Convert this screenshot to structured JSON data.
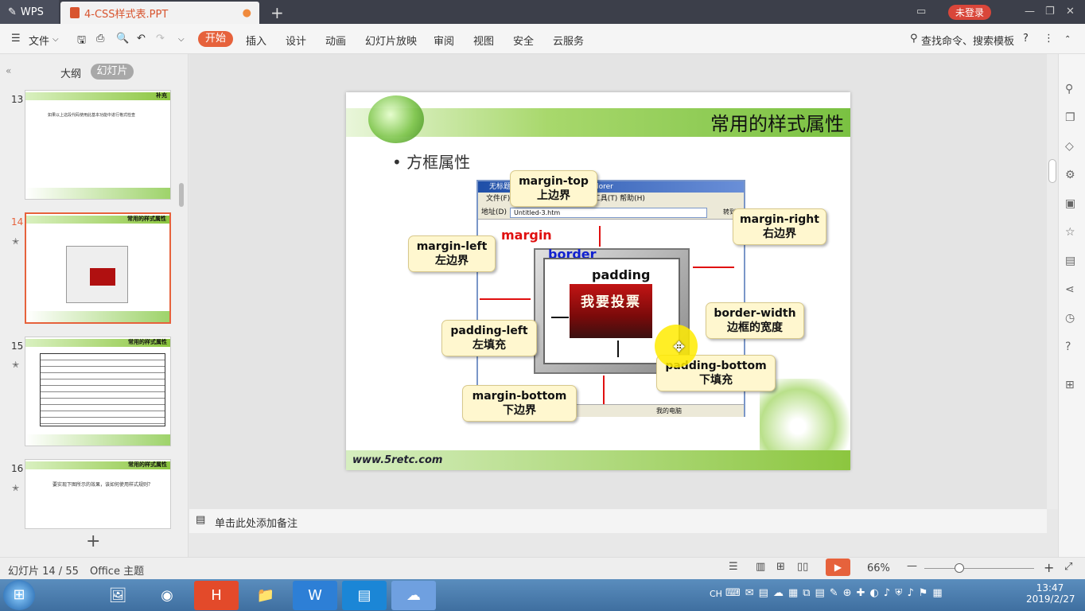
{
  "titlebar": {
    "app": "WPS",
    "doc_tab": "4-CSS样式表.PPT",
    "login": "未登录"
  },
  "menubar": {
    "file": "文件",
    "tabs": [
      "开始",
      "插入",
      "设计",
      "动画",
      "幻灯片放映",
      "审阅",
      "视图",
      "安全",
      "云服务"
    ],
    "search": "查找命令、搜索模板"
  },
  "left_panel": {
    "outline": "大纲",
    "slides": "幻灯片",
    "thumbs": [
      {
        "num": "13",
        "title": "补充",
        "text": "如果以上这段代码使用此基本功能中进行格式检查"
      },
      {
        "num": "14",
        "title": "常用的样式属性"
      },
      {
        "num": "15",
        "title": "常用的样式属性"
      },
      {
        "num": "16",
        "title": "常用的样式属性",
        "text": "要实现下图所示的效果，该如何使用样式规则？"
      }
    ]
  },
  "slide": {
    "title": "常用的样式属性",
    "bullet": "方框属性",
    "footer": "www.5retc.com",
    "ie": {
      "title": "无标题 - Microsoft Internet Explorer",
      "menu": "文件(F)  编辑(E)  查看(V)  收藏(A)  工具(T)  帮助(H)",
      "addr_label": "地址(D)",
      "addr": "Untitled-3.htm",
      "go": "转到",
      "status": "我的电脑"
    },
    "labels": {
      "margin": "margin",
      "border": "border",
      "padding": "padding",
      "vote": "我要投票"
    },
    "callouts": {
      "margin_top": [
        "margin-top",
        "上边界"
      ],
      "margin_right": [
        "margin-right",
        "右边界"
      ],
      "margin_left": [
        "margin-left",
        "左边界"
      ],
      "border_width": [
        "border-width",
        "边框的宽度"
      ],
      "padding_left": [
        "padding-left",
        "左填充"
      ],
      "padding_bottom": [
        "padding-bottom",
        "下填充"
      ],
      "margin_bottom": [
        "margin-bottom",
        "下边界"
      ]
    }
  },
  "notes": {
    "placeholder": "单击此处添加备注"
  },
  "status": {
    "slide": "幻灯片 14 / 55",
    "theme": "Office 主题",
    "zoom": "66%"
  },
  "taskbar": {
    "lang": "CH",
    "time": "13:47",
    "date": "2019/2/27"
  }
}
